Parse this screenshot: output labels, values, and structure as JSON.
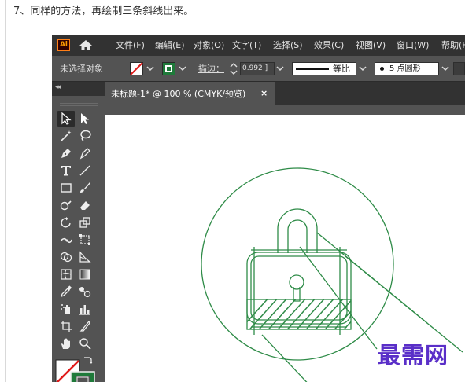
{
  "article": {
    "step_caption": "7、同样的方法，再绘制三条斜线出来。"
  },
  "app": {
    "logo_text": "Ai",
    "menu": [
      {
        "label": "文件(F)"
      },
      {
        "label": "编辑(E)"
      },
      {
        "label": "对象(O)"
      },
      {
        "label": "文字(T)"
      },
      {
        "label": "选择(S)"
      },
      {
        "label": "效果(C)"
      },
      {
        "label": "视图(V)"
      },
      {
        "label": "窗口(W)"
      },
      {
        "label": "帮助(H"
      }
    ]
  },
  "control_bar": {
    "selection_status": "未选择对象",
    "stroke_label": "描边：",
    "stroke_weight": "0.992 ]",
    "profile_label": "等比",
    "brush_label": "5 点圆形",
    "fill_color": "none",
    "stroke_color": "#1f7a3a"
  },
  "document": {
    "tab_title": "未标题-1* @ 100 % (CMYK/预览)",
    "close_glyph": "×"
  },
  "artwork": {
    "stroke_color": "#2e8b47",
    "subject": "padlock-in-circle"
  },
  "watermark": {
    "text": "最需网",
    "color": "#5a2fc8"
  }
}
